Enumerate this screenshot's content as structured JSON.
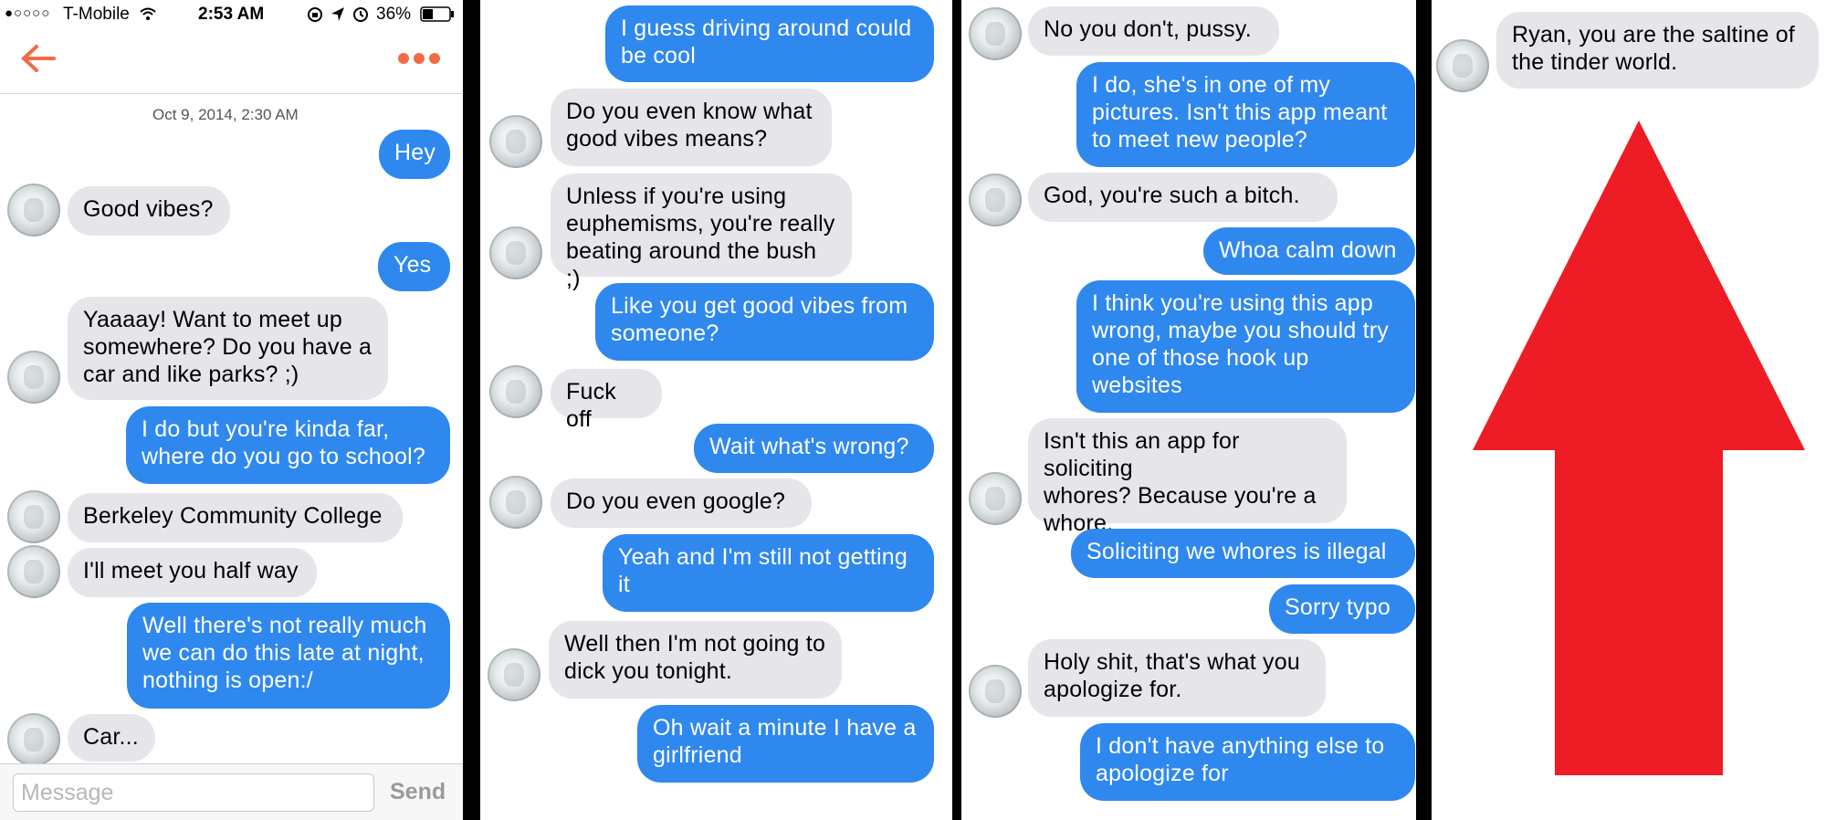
{
  "status_bar": {
    "signal": "●○○○○",
    "carrier": "T-Mobile",
    "time": "2:53 AM",
    "battery": "36%",
    "icons": [
      "wifi-icon",
      "rotation-lock-icon",
      "location-arrow-icon",
      "alarm-icon",
      "battery-icon"
    ]
  },
  "nav": {
    "back_icon": "back-arrow-icon",
    "more_icon": "more-dots-icon",
    "accent_color": "#f26b46"
  },
  "timestamp": "Oct 9, 2014, 2:30 AM",
  "colors": {
    "incoming": "#e5e5ea",
    "outgoing": "#2f88ee",
    "arrow": "#ee1c24"
  },
  "panel1": {
    "messages": [
      {
        "dir": "out",
        "text": "Hey"
      },
      {
        "dir": "in",
        "text": "Good vibes?"
      },
      {
        "dir": "out",
        "text": "Yes"
      },
      {
        "dir": "in",
        "text": "Yaaaay! Want to meet up\nsomewhere? Do you have a\ncar and like parks? ;)"
      },
      {
        "dir": "out",
        "text": "I do but you're kinda far,\nwhere do you go to school?"
      },
      {
        "dir": "in",
        "text": "Berkeley Community College"
      },
      {
        "dir": "in",
        "text": "I'll meet you half way"
      },
      {
        "dir": "out",
        "text": "Well there's not really much\nwe can do this late at night,\nnothing is open:/"
      },
      {
        "dir": "in",
        "text": "Car..."
      }
    ],
    "composer": {
      "placeholder": "Message",
      "send_label": "Send"
    }
  },
  "panel2": {
    "messages": [
      {
        "dir": "out",
        "text": "I guess driving around could\nbe cool"
      },
      {
        "dir": "in",
        "text": "Do you even know what\ngood vibes means?"
      },
      {
        "dir": "in",
        "text": "Unless if you're using\neuphemisms, you're really\nbeating around the bush ;)"
      },
      {
        "dir": "out",
        "text": "Like you get good vibes from\nsomeone?"
      },
      {
        "dir": "in",
        "text": "Fuck off"
      },
      {
        "dir": "out",
        "text": "Wait what's wrong?"
      },
      {
        "dir": "in",
        "text": "Do you even google?"
      },
      {
        "dir": "out",
        "text": "Yeah and I'm still not getting\nit"
      },
      {
        "dir": "in",
        "text": "Well then I'm not going to\ndick you tonight."
      },
      {
        "dir": "out",
        "text": "Oh wait a minute I have a\ngirlfriend"
      }
    ]
  },
  "panel3": {
    "messages": [
      {
        "dir": "in",
        "text": "No you don't, pussy."
      },
      {
        "dir": "out",
        "text": "I do, she's in one of my\npictures. Isn't this app meant\nto meet new people?"
      },
      {
        "dir": "in",
        "text": "God, you're such a bitch."
      },
      {
        "dir": "out",
        "text": "Whoa calm down"
      },
      {
        "dir": "out",
        "text": "I think you're using this app\nwrong, maybe you should try\none of those hook up\nwebsites"
      },
      {
        "dir": "in",
        "text": "Isn't this an app for soliciting\nwhores? Because you're a\nwhore."
      },
      {
        "dir": "out",
        "text": "Soliciting we whores is illegal"
      },
      {
        "dir": "out",
        "text": "Sorry typo"
      },
      {
        "dir": "in",
        "text": "Holy shit, that's what you\napologize for."
      },
      {
        "dir": "out",
        "text": "I don't have anything else to\napologize for"
      }
    ]
  },
  "panel4": {
    "messages": [
      {
        "dir": "in",
        "text": "Ryan, you are the saltine of\nthe tinder world."
      }
    ],
    "arrow_icon": "up-arrow-icon"
  }
}
